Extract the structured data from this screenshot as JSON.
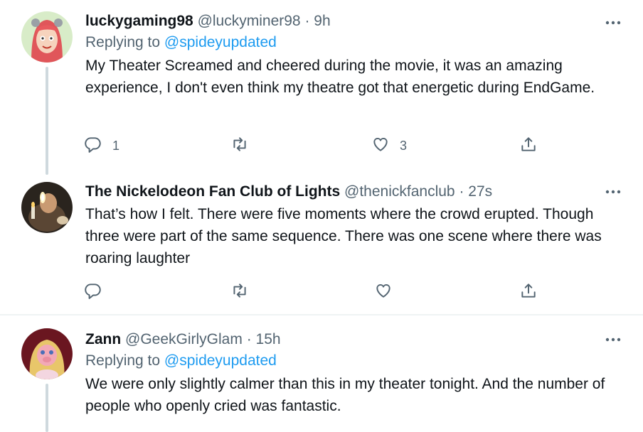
{
  "tweets": [
    {
      "name": "luckygaming98",
      "handle": "@luckyminer98",
      "dot": "·",
      "time": "9h",
      "replying_label": "Replying to",
      "replying_to": "@spideyupdated",
      "text": "My Theater Screamed and cheered during the movie, it was an amazing experience, I don't even think my theatre got that energetic during EndGame.",
      "reply_count": "1",
      "retweet_count": "",
      "like_count": "3"
    },
    {
      "name": "The Nickelodeon Fan Club of Lights",
      "handle": "@thenickfanclub",
      "dot": "·",
      "time": "27s",
      "text": "That’s how I felt. There were five moments where the crowd erupted. Though three were part of the same sequence. There was one scene where there was roaring laughter",
      "reply_count": "",
      "retweet_count": "",
      "like_count": ""
    },
    {
      "name": "Zann",
      "handle": "@GeekGirlyGlam",
      "dot": "·",
      "time": "15h",
      "replying_label": "Replying to",
      "replying_to": "@spideyupdated",
      "text": "We were only slightly calmer than this in my theater tonight. And the number of people who openly cried was fantastic."
    }
  ],
  "colors": {
    "text": "#0f1419",
    "secondary": "#536471",
    "link": "#1d9bf0",
    "thread_line": "#cfd9de",
    "divider": "#eff3f4"
  },
  "icons": [
    "reply-icon",
    "retweet-icon",
    "like-icon",
    "share-icon",
    "more-options-icon"
  ]
}
